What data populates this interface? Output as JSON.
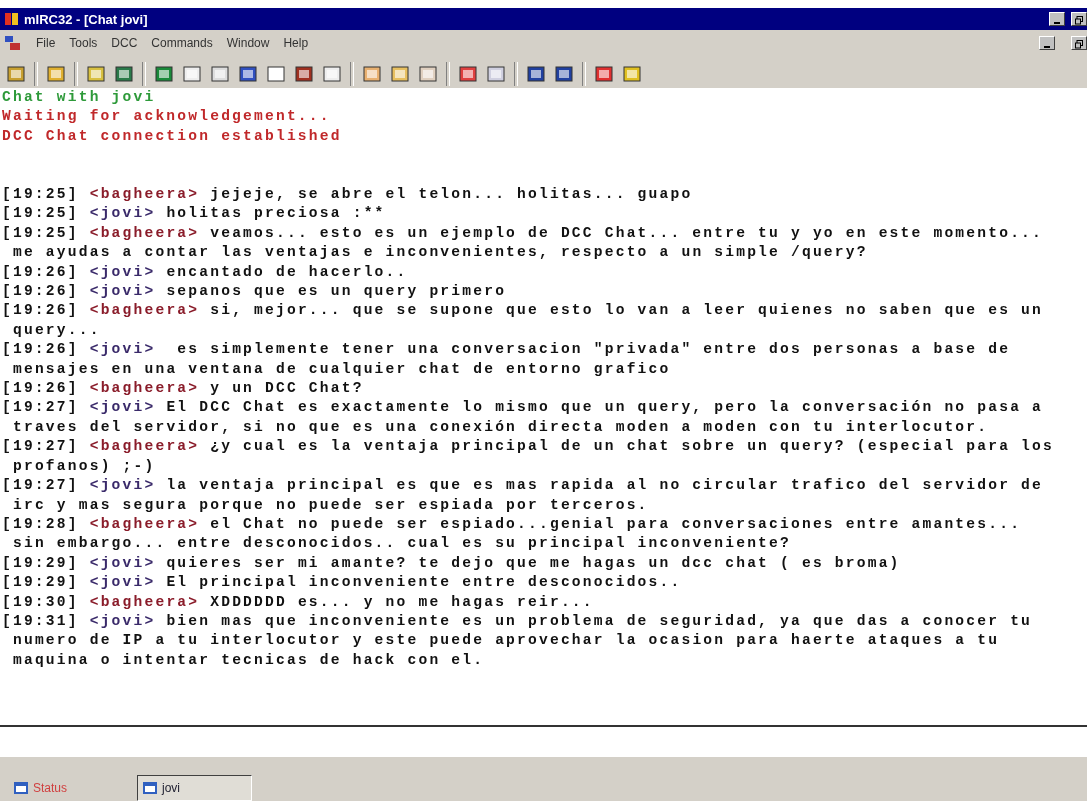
{
  "window": {
    "title": "mIRC32 - [Chat jovi]"
  },
  "menu": [
    {
      "label": "File"
    },
    {
      "label": "Tools"
    },
    {
      "label": "DCC"
    },
    {
      "label": "Commands"
    },
    {
      "label": "Window"
    },
    {
      "label": "Help"
    }
  ],
  "system_lines": [
    {
      "text": "Chat with jovi",
      "color": "#2e9a3a"
    },
    {
      "text": "Waiting for acknowledgement...",
      "color": "#c0282a"
    },
    {
      "text": "DCC Chat connection established",
      "color": "#c0282a"
    }
  ],
  "messages": [
    {
      "time": "[19:25]",
      "nick": "<bagheera>",
      "color": "#8a1c2a",
      "lines": [
        "jejeje, se abre el telon... holitas... guapo"
      ]
    },
    {
      "time": "[19:25]",
      "nick": "<jovi>",
      "color": "#3a2a6a",
      "lines": [
        "holitas preciosa :**"
      ]
    },
    {
      "time": "[19:25]",
      "nick": "<bagheera>",
      "color": "#8a1c2a",
      "lines": [
        "veamos... esto es un ejemplo de DCC Chat... entre tu y yo en este momento...",
        "me ayudas a contar las ventajas e inconvenientes, respecto a un simple /query?"
      ]
    },
    {
      "time": "[19:26]",
      "nick": "<jovi>",
      "color": "#3a2a6a",
      "lines": [
        "encantado de hacerlo.."
      ]
    },
    {
      "time": "[19:26]",
      "nick": "<jovi>",
      "color": "#3a2a6a",
      "lines": [
        "sepanos que es un query primero"
      ]
    },
    {
      "time": "[19:26]",
      "nick": "<bagheera>",
      "color": "#8a1c2a",
      "lines": [
        "si, mejor... que se supone que esto lo van a leer quienes no saben que es un",
        "query..."
      ]
    },
    {
      "time": "[19:26]",
      "nick": "<jovi>",
      "color": "#3a2a6a",
      "lines": [
        " es simplemente tener una conversacion \"privada\" entre dos personas a base de",
        "mensajes en una ventana de cualquier chat de entorno grafico"
      ]
    },
    {
      "time": "[19:26]",
      "nick": "<bagheera>",
      "color": "#8a1c2a",
      "lines": [
        "y un DCC Chat?"
      ]
    },
    {
      "time": "[19:27]",
      "nick": "<jovi>",
      "color": "#3a2a6a",
      "lines": [
        "El DCC Chat es exactamente lo mismo que un query, pero la conversación no pasa a",
        "traves del servidor, si no que es una conexión directa moden a moden con tu interlocutor."
      ]
    },
    {
      "time": "[19:27]",
      "nick": "<bagheera>",
      "color": "#8a1c2a",
      "lines": [
        "¿y cual es la ventaja principal de un chat sobre un query? (especial para los",
        "profanos) ;-)"
      ]
    },
    {
      "time": "[19:27]",
      "nick": "<jovi>",
      "color": "#3a2a6a",
      "lines": [
        "la ventaja principal es que es mas rapida al no circular trafico del servidor de",
        "irc y mas segura porque no puede ser espiada por terceros."
      ]
    },
    {
      "time": "[19:28]",
      "nick": "<bagheera>",
      "color": "#8a1c2a",
      "lines": [
        "el Chat no puede ser espiado...genial para conversaciones entre amantes...",
        "sin embargo... entre desconocidos.. cual es su principal inconveniente?"
      ]
    },
    {
      "time": "[19:29]",
      "nick": "<jovi>",
      "color": "#3a2a6a",
      "lines": [
        "quieres ser mi amante? te dejo que me hagas un dcc chat ( es broma)"
      ]
    },
    {
      "time": "[19:29]",
      "nick": "<jovi>",
      "color": "#3a2a6a",
      "lines": [
        "El principal inconveniente entre desconocidos.."
      ]
    },
    {
      "time": "[19:30]",
      "nick": "<bagheera>",
      "color": "#8a1c2a",
      "lines": [
        "XDDDDDD es... y no me hagas reir..."
      ]
    },
    {
      "time": "[19:31]",
      "nick": "<jovi>",
      "color": "#3a2a6a",
      "lines": [
        "bien mas que inconveniente es un problema de seguridad, ya que das a conocer tu",
        "numero de IP a tu interlocutor y este puede aprovechar la ocasion para haerte ataques a tu",
        "maquina o intentar tecnicas de hack con el."
      ]
    }
  ],
  "taskbar": [
    {
      "label": "Status",
      "selected": false
    },
    {
      "label": "jovi",
      "selected": true
    }
  ]
}
